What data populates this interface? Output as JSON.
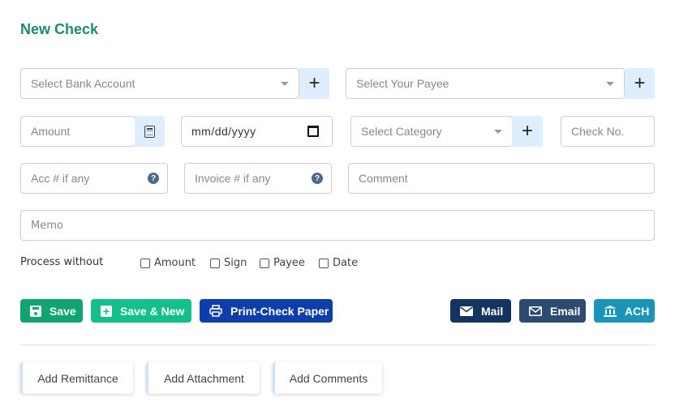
{
  "title": "New Check",
  "row1": {
    "bank_account": {
      "placeholder": "Select Bank Account"
    },
    "payee": {
      "placeholder": "Select Your Payee"
    },
    "add_label": "+"
  },
  "row2": {
    "amount": {
      "placeholder": "Amount"
    },
    "date": {
      "placeholder": "mm/dd/yyyy"
    },
    "category": {
      "placeholder": "Select Category"
    },
    "check_no": {
      "placeholder": "Check No."
    },
    "add_label": "+"
  },
  "row3": {
    "acc": {
      "placeholder": "Acc # if any"
    },
    "invoice": {
      "placeholder": "Invoice # if any"
    },
    "comment": {
      "placeholder": "Comment"
    },
    "help_label": "?"
  },
  "memo": {
    "placeholder": "Memo"
  },
  "process_without": {
    "label": "Process without",
    "options": [
      {
        "label": "Amount",
        "checked": false
      },
      {
        "label": "Sign",
        "checked": false
      },
      {
        "label": "Payee",
        "checked": false
      },
      {
        "label": "Date",
        "checked": false
      }
    ]
  },
  "actions": {
    "save": "Save",
    "save_new": "Save & New",
    "print": "Print-Check Paper",
    "mail": "Mail",
    "email": "Email",
    "ach": "ACH"
  },
  "extras": {
    "remittance": "Add Remittance",
    "attachment": "Add Attachment",
    "comments": "Add Comments"
  },
  "colors": {
    "title": "#1f8a70",
    "save": "#0fa573",
    "save_new": "#13bf8b",
    "print": "#0e3eaa",
    "mail": "#12345f",
    "email": "#2d4a70",
    "ach": "#1a94b7",
    "addon_bg": "#dfeeff"
  }
}
